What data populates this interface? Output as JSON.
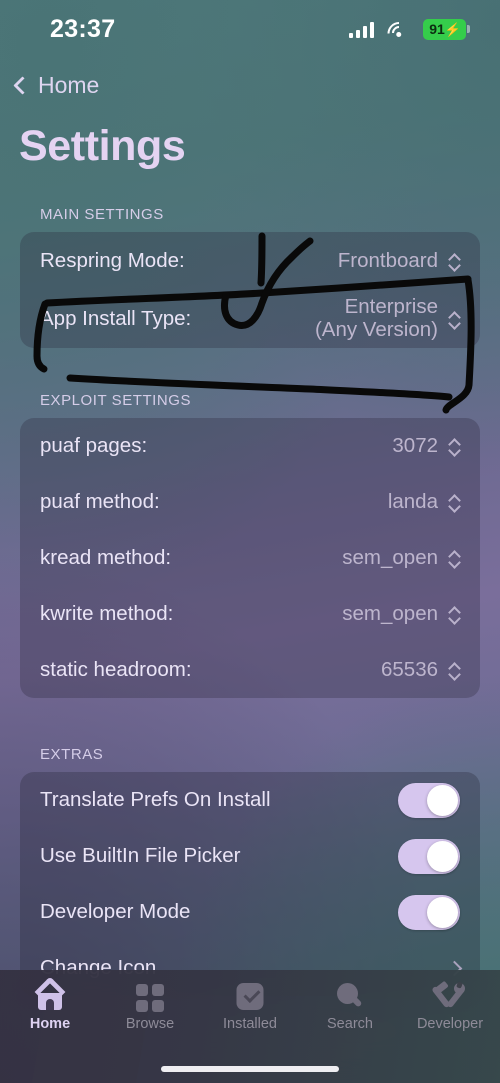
{
  "status_bar": {
    "time": "23:37",
    "battery_percent": "91",
    "battery_bolt": "⚡",
    "icons": [
      "signal-icon",
      "wifi-icon",
      "battery-icon"
    ]
  },
  "nav": {
    "back_label": "Home",
    "back_icon": "chevron-left-icon"
  },
  "page_title": "Settings",
  "sections": [
    {
      "header": "MAIN SETTINGS",
      "rows": [
        {
          "label": "Respring Mode:",
          "value": "Frontboard",
          "control": "updown-picker"
        },
        {
          "label": "App Install Type:",
          "value_line1": "Enterprise",
          "value_line2": "(Any Version)",
          "control": "updown-picker"
        }
      ]
    },
    {
      "header": "EXPLOIT SETTINGS",
      "rows": [
        {
          "label": "puaf pages:",
          "value": "3072",
          "control": "updown-picker"
        },
        {
          "label": "puaf method:",
          "value": "landa",
          "control": "updown-picker"
        },
        {
          "label": "kread method:",
          "value": "sem_open",
          "control": "updown-picker"
        },
        {
          "label": "kwrite method:",
          "value": "sem_open",
          "control": "updown-picker"
        },
        {
          "label": "static headroom:",
          "value": "65536",
          "control": "updown-picker"
        }
      ]
    },
    {
      "header": "EXTRAS",
      "rows": [
        {
          "label": "Translate Prefs On Install",
          "control": "toggle",
          "state": "on"
        },
        {
          "label": "Use BuiltIn File Picker",
          "control": "toggle",
          "state": "on"
        },
        {
          "label": "Developer Mode",
          "control": "toggle",
          "state": "on"
        },
        {
          "label": "Change Icon",
          "control": "disclosure",
          "icon": "chevron-right-icon"
        }
      ]
    }
  ],
  "tabbar": {
    "items": [
      {
        "label": "Home",
        "icon": "home-icon",
        "active": true
      },
      {
        "label": "Browse",
        "icon": "grid-icon",
        "active": false
      },
      {
        "label": "Installed",
        "icon": "checkbox-icon",
        "active": false
      },
      {
        "label": "Search",
        "icon": "magnifier-icon",
        "active": false
      },
      {
        "label": "Developer",
        "icon": "hammer-wrench-icon",
        "active": false
      }
    ]
  },
  "annotation": {
    "type": "hand-drawn-ink",
    "color": "#0a0a0a",
    "shapes": [
      "rectangle-around-app-install-type-row",
      "checkmark-stroke"
    ]
  },
  "colors": {
    "accent": "#d6c6ee",
    "battery_green": "#35cd4b",
    "card": "rgba(42,40,58,0.30)",
    "title": "#e4d3f2"
  }
}
